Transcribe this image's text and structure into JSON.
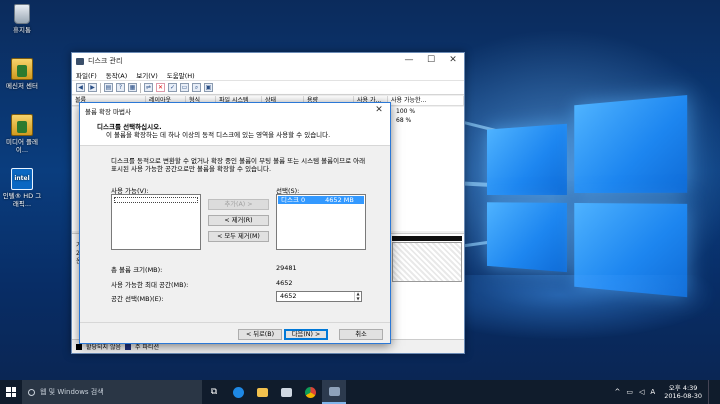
{
  "desktop": {
    "icons": [
      {
        "label": "휴지통",
        "icon": "recycle-bin-icon"
      },
      {
        "label": "메신저 센터",
        "icon": "messenger-center-icon"
      },
      {
        "label": "미디어 플레이...",
        "icon": "media-player-icon"
      },
      {
        "label": "인텔® HD 그래픽...",
        "icon": "intel-hd-graphics-icon"
      }
    ]
  },
  "disk_manager": {
    "title": "디스크 관리",
    "menu": [
      "파일(F)",
      "동작(A)",
      "보기(V)",
      "도움말(H)"
    ],
    "columns": [
      "볼륨",
      "레이아웃",
      "형식",
      "파일 시스템",
      "상태",
      "용량",
      "사용 가...",
      "사용 가능한..."
    ],
    "rows": [
      {
        "pct": "100 %"
      },
      {
        "pct": "68 %"
      }
    ],
    "disk_label_lines": [
      "기",
      "28",
      "온"
    ],
    "legend": [
      {
        "label": "할당되지 않음",
        "color": "#000000"
      },
      {
        "label": "주 파티션",
        "color": "#1e2f7a"
      }
    ]
  },
  "wizard": {
    "title": "볼륨 확장 마법사",
    "header_title": "디스크를 선택하십시오.",
    "header_subtitle": "이 볼륨을 확장하는 데 하나 이상의 동적 디스크에 있는 영역을 사용할 수 있습니다.",
    "description_line1": "디스크를 동적으로 변환할 수 없거나 확장 중인 볼륨이 부팅 볼륨 또는 시스템 볼륨이므로 아래",
    "description_line2": "표시된 사용 가능한 공간으로만 볼륨을 확장할 수 있습니다.",
    "available_label": "사용 가능(V):",
    "selected_label": "선택(S):",
    "add_button": "추가(A) >",
    "remove_button": "< 제거(R)",
    "remove_all_button": "< 모두 제거(M)",
    "selected_items": [
      {
        "disk": "디스크 0",
        "size": "4652 MB"
      }
    ],
    "total_size_label": "총 볼륨 크기(MB):",
    "total_size_value": "29481",
    "max_space_label": "사용 가능한 최대 공간(MB):",
    "max_space_value": "4652",
    "select_space_label": "공간 선택(MB)(E):",
    "select_space_value": "4652",
    "back_button": "< 뒤로(B)",
    "next_button": "다음(N) >",
    "cancel_button": "취소"
  },
  "taskbar": {
    "search_placeholder": "웹 및 Windows 검색",
    "time": "오후 4:39",
    "date": "2016-08-30",
    "ime": "A",
    "apps": [
      "task-view-icon",
      "edge-icon",
      "file-explorer-icon",
      "store-icon",
      "chrome-icon",
      "disk-management-icon"
    ]
  }
}
